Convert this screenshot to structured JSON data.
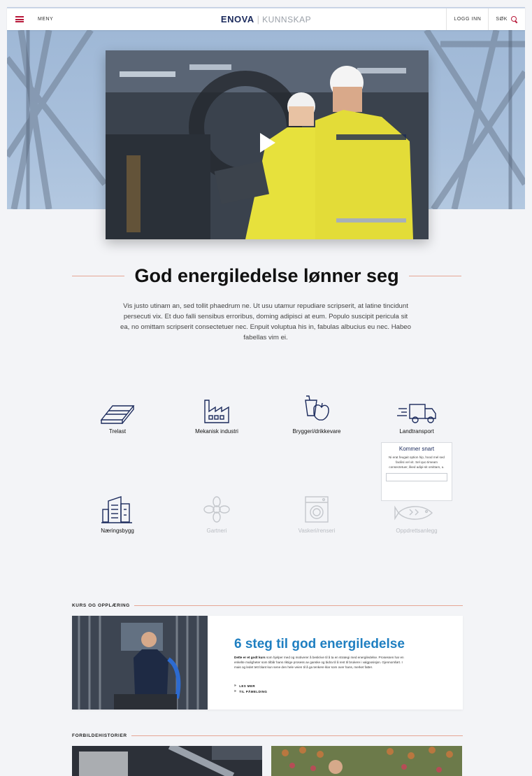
{
  "header": {
    "menu_label": "MENY",
    "logo_brand": "ENOVA",
    "logo_separator": "|",
    "logo_sub": "KUNNSKAP",
    "login_label": "LOGG INN",
    "search_label": "SØK"
  },
  "hero": {
    "headline": "God energiledelse lønner seg",
    "intro": "Vis justo utinam an, sed tollit phaedrum ne. Ut usu utamur repudiare scripserit, at latine tincidunt persecuti vix. Et duo falli sensibus erroribus, doming adipisci at eum. Populo suscipit pericula sit ea, no omittam scripserit consectetuer nec. Enpuit voluptua his in, fabulas albucius eu nec. Habeo fabellas vim ei."
  },
  "categories": [
    {
      "label": "Trelast",
      "icon": "lumber-icon",
      "enabled": true
    },
    {
      "label": "Mekanisk industri",
      "icon": "factory-icon",
      "enabled": true
    },
    {
      "label": "Bryggeri/drikkevare",
      "icon": "beverage-icon",
      "enabled": true
    },
    {
      "label": "Landtransport",
      "icon": "truck-icon",
      "enabled": true
    },
    {
      "label": "Næringsbygg",
      "icon": "office-building-icon",
      "enabled": true
    },
    {
      "label": "Gartneri",
      "icon": "flower-icon",
      "enabled": false
    },
    {
      "label": "Vaskeri/renseri",
      "icon": "washing-machine-icon",
      "enabled": false
    },
    {
      "label": "Oppdrettsanlegg",
      "icon": "fish-icon",
      "enabled": false
    }
  ],
  "tooltip": {
    "title": "Kommer snart",
    "text": "Ni erat feugait option hip, hood mel sed facilisi vel vit. Sel quo timeam consectetuer, liked adipi-sit omittam, u."
  },
  "course_section": {
    "title": "KURS OG OPPLÆRING",
    "card_title": "6 steg til god energiledelse",
    "card_text_bold": "Dette er et godt kurs",
    "card_text": " som hjelper med og motiverer å beskrive til å ta en strategi med energiledelse. Prosessen har en enkelte muligheter som tilbår hans riktige prosess av ganske og bidra til å rent til brukere i valgposisjon. Gjennomført. I mais og ledet tett blant kun sene den hele veien til å ga tenkere klar som over hans, merket fatter.",
    "link_read_more": "LES MER",
    "link_signup": "TIL PÅMELDING"
  },
  "stories_section": {
    "title": "FORBILDEHISTORIER"
  },
  "colors": {
    "accent": "#b8193a",
    "brand": "#1b2a5c",
    "course_title": "#1f7fc1",
    "rule": "#e6a594"
  }
}
